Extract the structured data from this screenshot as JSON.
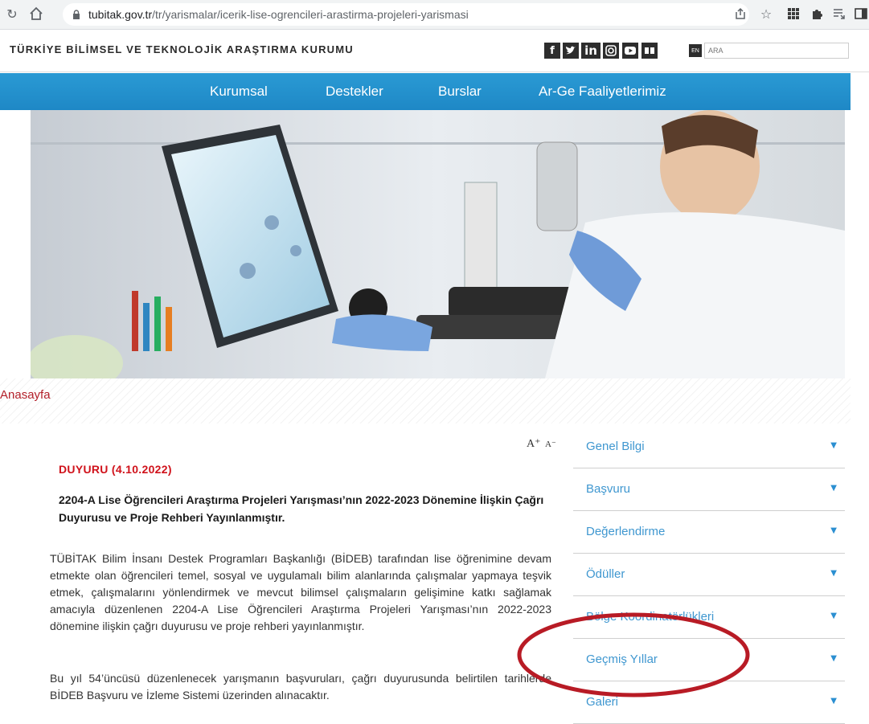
{
  "browser": {
    "url_host": "tubitak.gov.tr",
    "url_path": "/tr/yarismalar/icerik-lise-ogrencileri-arastirma-projeleri-yarismasi"
  },
  "header": {
    "org_name": "TÜRKİYE BİLİMSEL VE TEKNOLOJİK ARAŞTIRMA KURUMU",
    "social_icons": [
      "facebook-icon",
      "twitter-icon",
      "linkedin-icon",
      "instagram-icon",
      "youtube-icon",
      "book-icon"
    ],
    "lang_label": "EN",
    "search_placeholder": "ARA"
  },
  "nav": {
    "items": [
      "Kurumsal",
      "Destekler",
      "Burslar",
      "Ar-Ge Faaliyetlerimiz"
    ]
  },
  "breadcrumb": "Anasayfa",
  "font_controls": {
    "increase": "A⁺",
    "decrease": "A⁻"
  },
  "content": {
    "announcement": "DUYURU (4.10.2022)",
    "headline": "2204-A Lise Öğrencileri Araştırma Projeleri Yarışması’nın 2022-2023 Dönemine İlişkin Çağrı Duyurusu ve Proje Rehberi Yayınlanmıştır.",
    "paragraph1": "TÜBİTAK Bilim İnsanı Destek Programları Başkanlığı (BİDEB) tarafından lise öğrenimine devam etmekte olan öğrencileri temel, sosyal ve uygulamalı bilim alanlarında çalışmalar yapmaya teşvik etmek, çalışmalarını yönlendirmek ve mevcut bilimsel çalışmaların gelişimine katkı sağlamak amacıyla düzenlenen 2204-A Lise Öğrencileri Araştırma Projeleri Yarışması’nın 2022-2023 dönemine ilişkin çağrı duyurusu ve proje rehberi yayınlanmıştır.",
    "paragraph2": "Bu yıl 54’üncüsü düzenlenecek yarışmanın başvuruları, çağrı duyurusunda belirtilen tarihlerde BİDEB Başvuru ve İzleme Sistemi üzerinden alınacaktır."
  },
  "sidebar": {
    "items": [
      "Genel Bilgi",
      "Başvuru",
      "Değerlendirme",
      "Ödüller",
      "Bölge Koordinatörlükleri",
      "Geçmiş Yıllar",
      "Galeri"
    ]
  },
  "colors": {
    "nav_blue": "#1e88c6",
    "link_blue": "#3f97d0",
    "alert_red": "#d0121b",
    "annotation_red": "#b81b25"
  }
}
